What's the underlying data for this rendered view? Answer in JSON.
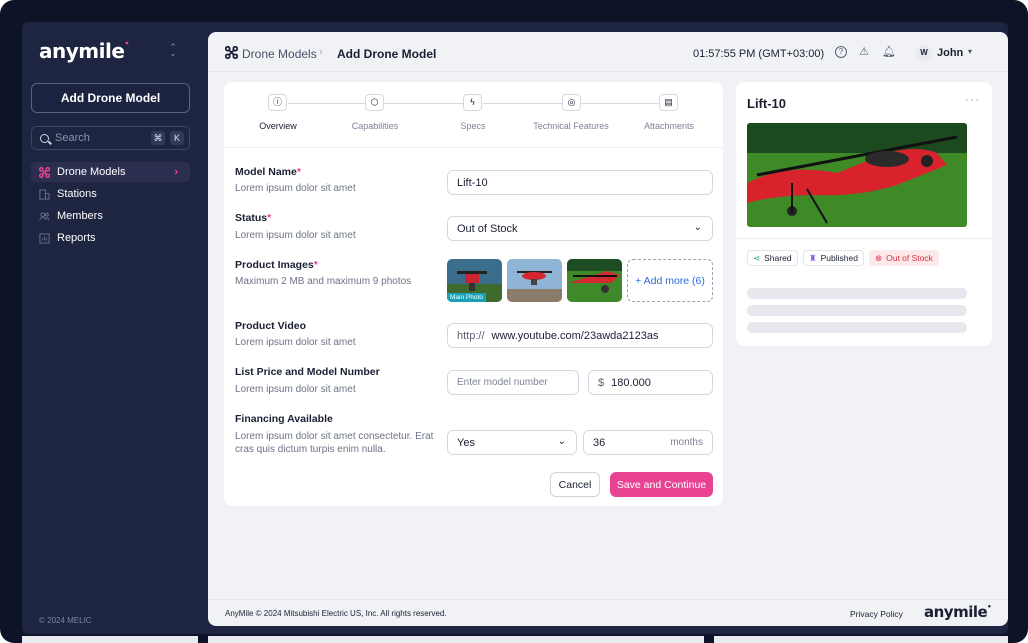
{
  "brand": {
    "logo_text": "anymile",
    "accent": "#e84393"
  },
  "sidebar": {
    "add_button": "Add Drone Model",
    "search_placeholder": "Search",
    "kbd": [
      "⌘",
      "K"
    ],
    "items": [
      {
        "label": "Drone Models",
        "icon": "drone-icon",
        "active": true
      },
      {
        "label": "Stations",
        "icon": "building-icon"
      },
      {
        "label": "Members",
        "icon": "users-icon"
      },
      {
        "label": "Reports",
        "icon": "chart-icon"
      }
    ],
    "copyright": "© 2024 MELIC"
  },
  "topbar": {
    "breadcrumb": [
      "Drone Models",
      "Add Drone Model"
    ],
    "time": "01:57:55 PM (GMT+03:00)",
    "avatar_initial": "W",
    "user_name": "John"
  },
  "steps": [
    {
      "label": "Overview",
      "icon": "info-icon",
      "active": true
    },
    {
      "label": "Capabilities",
      "icon": "cube-icon"
    },
    {
      "label": "Specs",
      "icon": "bolt-icon"
    },
    {
      "label": "Technical Features",
      "icon": "satellite-icon"
    },
    {
      "label": "Attachments",
      "icon": "file-icon"
    }
  ],
  "form": {
    "model_name": {
      "label": "Model Name",
      "desc": "Lorem ipsum dolor sit amet",
      "value": "Lift-10"
    },
    "status": {
      "label": "Status",
      "desc": "Lorem ipsum dolor sit amet",
      "value": "Out of Stock"
    },
    "images": {
      "label": "Product Images",
      "desc": "Maximum 2 MB and maximum 9 photos",
      "main_photo": "Main Photo",
      "add_more": "+ Add more (6)"
    },
    "video": {
      "label": "Product Video",
      "desc": "Lorem ipsum dolor sit amet",
      "prefix": "http://",
      "value": "www.youtube.com/23awda2123as"
    },
    "price": {
      "label": "List Price and Model Number",
      "desc": "Lorem ipsum dolor sit amet",
      "model_placeholder": "Enter model number",
      "currency": "$",
      "value": "180.000"
    },
    "financing": {
      "label": "Financing Available",
      "desc": "Lorem ipsum dolor sit amet consectetur. Erat cras quis dictum turpis enim nulla.",
      "value": "Yes",
      "months_value": "36",
      "months_suffix": "months"
    },
    "cancel": "Cancel",
    "save": "Save and Continue"
  },
  "preview": {
    "title": "Lift-10",
    "badges": [
      {
        "label": "Shared",
        "icon": "share-icon"
      },
      {
        "label": "Published",
        "icon": "rocket-icon"
      },
      {
        "label": "Out of Stock",
        "icon": "x-circle-icon"
      }
    ]
  },
  "footer": {
    "text": "AnyMile © 2024 Mitsubishi Electric US, Inc. All rights reserved.",
    "privacy": "Privacy Policy",
    "logo_text": "anymile"
  }
}
